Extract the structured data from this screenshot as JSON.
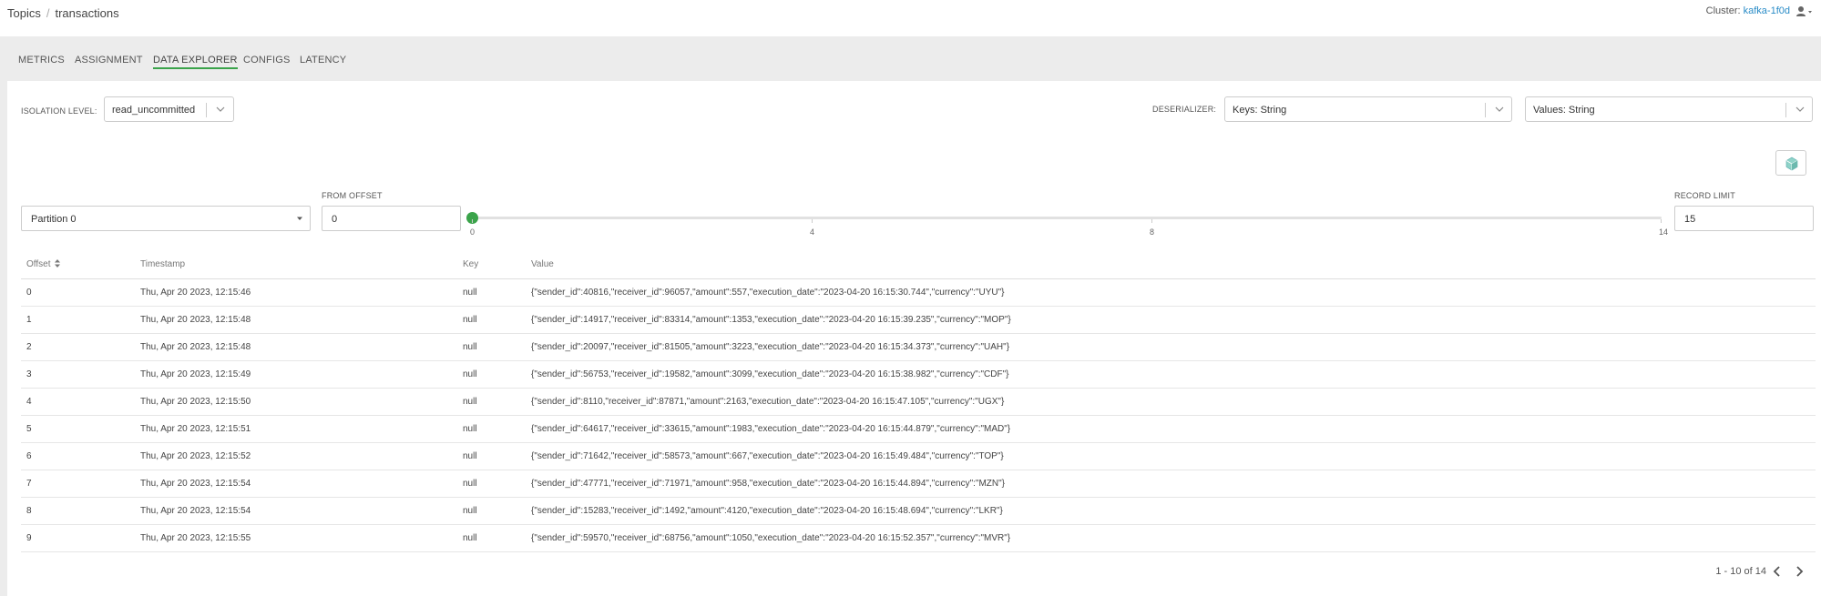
{
  "breadcrumb": {
    "root": "Topics",
    "separator": "/",
    "current": "transactions"
  },
  "cluster": {
    "label": "Cluster:",
    "name": "kafka-1f0d"
  },
  "tabs": [
    "METRICS",
    "ASSIGNMENT",
    "DATA EXPLORER",
    "CONFIGS",
    "LATENCY"
  ],
  "active_tab": "DATA EXPLORER",
  "isolation": {
    "label": "ISOLATION LEVEL:",
    "value": "read_uncommitted"
  },
  "deserializer": {
    "label": "DESERIALIZER:",
    "keys": "Keys: String",
    "values": "Values: String"
  },
  "partition": {
    "value": "Partition 0"
  },
  "offset": {
    "label": "FROM OFFSET",
    "value": "0"
  },
  "slider": {
    "ticks": [
      "0",
      "4",
      "8",
      "14"
    ],
    "min": 0,
    "max": 14,
    "value": 0
  },
  "record_limit": {
    "label": "RECORD LIMIT",
    "value": "15"
  },
  "table": {
    "headers": {
      "offset": "Offset",
      "timestamp": "Timestamp",
      "key": "Key",
      "value": "Value"
    },
    "rows": [
      {
        "offset": "0",
        "timestamp": "Thu, Apr 20 2023, 12:15:46",
        "key": "null",
        "value": "{\"sender_id\":40816,\"receiver_id\":96057,\"amount\":557,\"execution_date\":\"2023-04-20 16:15:30.744\",\"currency\":\"UYU\"}"
      },
      {
        "offset": "1",
        "timestamp": "Thu, Apr 20 2023, 12:15:48",
        "key": "null",
        "value": "{\"sender_id\":14917,\"receiver_id\":83314,\"amount\":1353,\"execution_date\":\"2023-04-20 16:15:39.235\",\"currency\":\"MOP\"}"
      },
      {
        "offset": "2",
        "timestamp": "Thu, Apr 20 2023, 12:15:48",
        "key": "null",
        "value": "{\"sender_id\":20097,\"receiver_id\":81505,\"amount\":3223,\"execution_date\":\"2023-04-20 16:15:34.373\",\"currency\":\"UAH\"}"
      },
      {
        "offset": "3",
        "timestamp": "Thu, Apr 20 2023, 12:15:49",
        "key": "null",
        "value": "{\"sender_id\":56753,\"receiver_id\":19582,\"amount\":3099,\"execution_date\":\"2023-04-20 16:15:38.982\",\"currency\":\"CDF\"}"
      },
      {
        "offset": "4",
        "timestamp": "Thu, Apr 20 2023, 12:15:50",
        "key": "null",
        "value": "{\"sender_id\":8110,\"receiver_id\":87871,\"amount\":2163,\"execution_date\":\"2023-04-20 16:15:47.105\",\"currency\":\"UGX\"}"
      },
      {
        "offset": "5",
        "timestamp": "Thu, Apr 20 2023, 12:15:51",
        "key": "null",
        "value": "{\"sender_id\":64617,\"receiver_id\":33615,\"amount\":1983,\"execution_date\":\"2023-04-20 16:15:44.879\",\"currency\":\"MAD\"}"
      },
      {
        "offset": "6",
        "timestamp": "Thu, Apr 20 2023, 12:15:52",
        "key": "null",
        "value": "{\"sender_id\":71642,\"receiver_id\":58573,\"amount\":667,\"execution_date\":\"2023-04-20 16:15:49.484\",\"currency\":\"TOP\"}"
      },
      {
        "offset": "7",
        "timestamp": "Thu, Apr 20 2023, 12:15:54",
        "key": "null",
        "value": "{\"sender_id\":47771,\"receiver_id\":71971,\"amount\":958,\"execution_date\":\"2023-04-20 16:15:44.894\",\"currency\":\"MZN\"}"
      },
      {
        "offset": "8",
        "timestamp": "Thu, Apr 20 2023, 12:15:54",
        "key": "null",
        "value": "{\"sender_id\":15283,\"receiver_id\":1492,\"amount\":4120,\"execution_date\":\"2023-04-20 16:15:48.694\",\"currency\":\"LKR\"}"
      },
      {
        "offset": "9",
        "timestamp": "Thu, Apr 20 2023, 12:15:55",
        "key": "null",
        "value": "{\"sender_id\":59570,\"receiver_id\":68756,\"amount\":1050,\"execution_date\":\"2023-04-20 16:15:52.357\",\"currency\":\"MVR\"}"
      }
    ]
  },
  "pagination": {
    "text": "1 - 10 of 14"
  },
  "colors": {
    "accent": "#3aa34a",
    "link": "#2a8cc7",
    "band": "#ececec"
  },
  "icons": [
    "user-icon",
    "chevron-down-icon",
    "caret-down-icon",
    "sort-icon",
    "cube-icon",
    "chevron-left-icon",
    "chevron-right-icon"
  ]
}
